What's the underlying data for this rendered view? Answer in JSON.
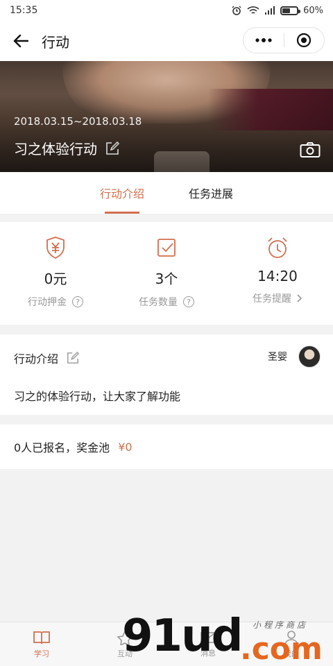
{
  "status_bar": {
    "time": "15:35",
    "battery": "60%",
    "battery_level": 0.6
  },
  "nav": {
    "title": "行动",
    "back_icon": "arrow-left-icon",
    "menu_icon": "more-dots-icon",
    "close_icon": "target-close-icon"
  },
  "banner": {
    "date_range": "2018.03.15~2018.03.18",
    "title": "习之体验行动",
    "edit_icon": "edit-icon",
    "camera_icon": "camera-icon"
  },
  "tabs": [
    {
      "label": "行动介绍",
      "active": true
    },
    {
      "label": "任务进展",
      "active": false
    }
  ],
  "stats": [
    {
      "icon": "shield-yen-icon",
      "value": "0元",
      "label": "行动押金",
      "suffix_icon": "question-icon"
    },
    {
      "icon": "checkbox-icon",
      "value": "3个",
      "label": "任务数量",
      "suffix_icon": "question-icon"
    },
    {
      "icon": "alarm-clock-icon",
      "value": "14:20",
      "label": "任务提醒",
      "suffix_icon": "chevron-right-icon"
    }
  ],
  "intro": {
    "heading": "行动介绍",
    "author": "圣婴",
    "text": "习之的体验行动，让大家了解功能"
  },
  "pool": {
    "text": "0人已报名，奖金池",
    "amount": "¥0"
  },
  "tabbar": [
    {
      "label": "学习",
      "icon": "book-icon",
      "active": true
    },
    {
      "label": "互动",
      "icon": "star-icon",
      "active": false
    },
    {
      "label": "消息",
      "icon": "mail-icon",
      "active": false
    },
    {
      "label": "我的",
      "icon": "person-icon",
      "active": false
    }
  ],
  "watermark": {
    "main": "91ud",
    "suffix": ".com",
    "small": "小程序商店"
  },
  "colors": {
    "accent": "#d36e4e",
    "background": "#f2f2f2"
  }
}
